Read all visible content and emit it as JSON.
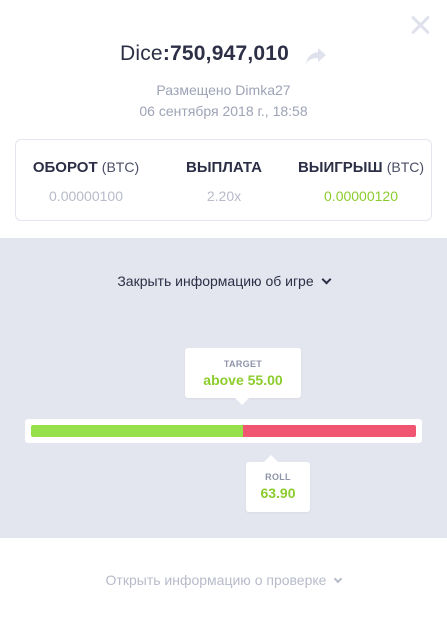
{
  "header": {
    "game": "Dice",
    "bet_id": "750,947,010"
  },
  "meta": {
    "placed_by": "Размещено Dimka27",
    "placed_at": "06 сентября 2018 г., 18:58"
  },
  "stats": [
    {
      "label": "ОБОРОТ",
      "unit": "(BTC)",
      "value": "0.00000100"
    },
    {
      "label": "ВЫПЛАТА",
      "unit": "",
      "value": "2.20x"
    },
    {
      "label": "ВЫИГРЫШ",
      "unit": "(BTC)",
      "value": "0.00000120"
    }
  ],
  "game_panel": {
    "toggle_label": "Закрыть информацию об игре",
    "target": {
      "label": "TARGET",
      "value": "above 55.00",
      "threshold": 55.0
    },
    "roll": {
      "label": "ROLL",
      "value": "63.90"
    },
    "bar_colors": {
      "low": "#96e04b",
      "high": "#f05671"
    }
  },
  "footer": {
    "verify_label": "Открыть информацию о проверке"
  },
  "icons": [
    "close-icon",
    "share-icon",
    "chevron-down-icon"
  ]
}
